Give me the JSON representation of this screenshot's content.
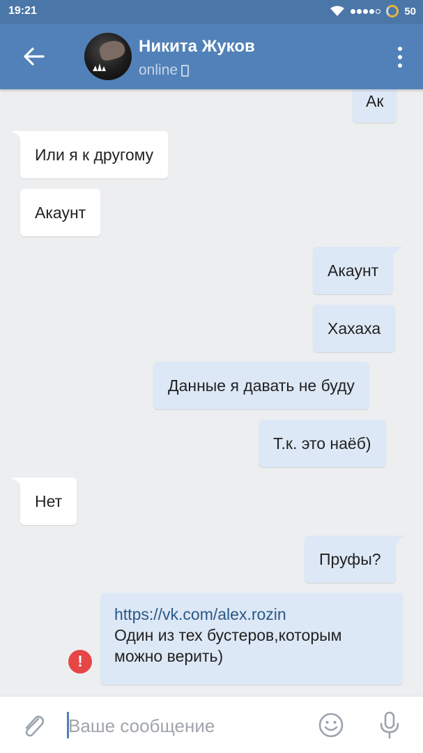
{
  "status_bar": {
    "time": "19:21",
    "battery": "50",
    "wifi_icon": "wifi-icon",
    "signal_icon": "signal-dots-icon",
    "battery_icon": "battery-ring-icon"
  },
  "header": {
    "name": "Никита Жуков",
    "status": "online",
    "status_device_icon": "mobile-phone-icon",
    "back_icon": "arrow-left-icon",
    "menu_icon": "more-vertical-icon"
  },
  "messages": [
    {
      "dir": "out",
      "text": "Ак"
    },
    {
      "dir": "in",
      "text": "Или я к другому"
    },
    {
      "dir": "in",
      "text": "Акаунт"
    },
    {
      "dir": "out",
      "text": "Акаунт"
    },
    {
      "dir": "out",
      "text": "Хахаха"
    },
    {
      "dir": "out",
      "text": "Данные я давать не буду"
    },
    {
      "dir": "out",
      "text": "Т.к. это наёб)"
    },
    {
      "dir": "in",
      "text": "Нет"
    },
    {
      "dir": "out",
      "text": "Пруфы?"
    },
    {
      "dir": "out",
      "link": "https://vk.com/alex.rozin",
      "line1": "Один из тех бустеров,которым",
      "line2": "можно верить)",
      "error": "!"
    }
  ],
  "input": {
    "placeholder": "Ваше сообщение",
    "value": "",
    "attach_icon": "paperclip-icon",
    "emoji_icon": "smile-icon",
    "mic_icon": "microphone-icon"
  },
  "colors": {
    "header_bg": "#5181b8",
    "statusbar_bg": "#4a76a8",
    "chat_bg": "#edeef0",
    "bubble_in": "#ffffff",
    "bubble_out": "#dde8f6",
    "link": "#2a5885",
    "error": "#e64646"
  }
}
